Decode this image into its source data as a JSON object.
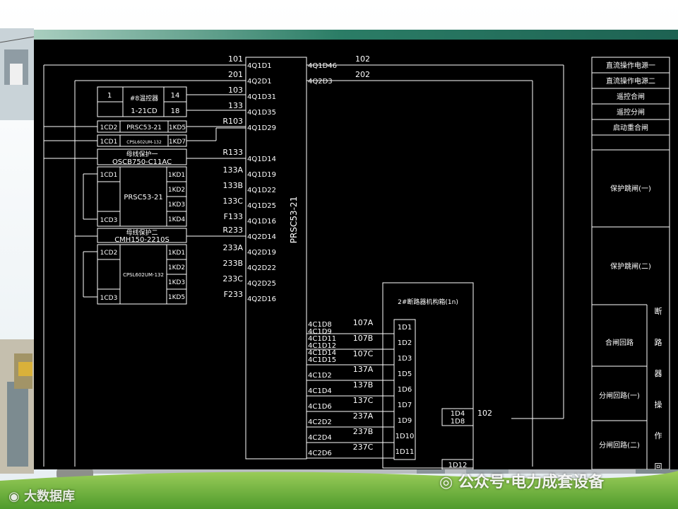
{
  "colors": {
    "panel": "#000000",
    "line": "#ffffff",
    "header_bar": "#1f6f5a",
    "grass": "#6fb23a"
  },
  "left_devices": [
    {
      "ref": "measure",
      "label1": "1",
      "label2": "#8温控器",
      "label3": "1-21CD",
      "label4": "14",
      "label5": "18"
    },
    {
      "ref": "dev2",
      "left": "1CD2",
      "mid": "PRSC53-21",
      "right": "1KD5"
    },
    {
      "ref": "dev3",
      "left": "1CD1",
      "mid": "CPSL602UM-132",
      "right": "1KD7"
    },
    {
      "ref": "bus1",
      "title1": "母线保护一",
      "title2": "OSCB750-C11AC"
    },
    {
      "ref": "prot1",
      "lt": "1CD1",
      "lb": "1CD3",
      "mid": "PRSC53-21",
      "r": [
        "1KD1",
        "1KD2",
        "1KD3",
        "1KD4"
      ]
    },
    {
      "ref": "bus2",
      "title1": "母线保护二",
      "title2": "CMH150-2210S"
    },
    {
      "ref": "prot2",
      "lt": "1CD2",
      "lb": "1CD3",
      "mid": "CPSL602UM-132",
      "r": [
        "1KD1",
        "1KD2",
        "1KD3",
        "1KD5"
      ]
    }
  ],
  "wire_labels_left": [
    "101",
    "201",
    "103",
    "133",
    "R103",
    "R133",
    "133A",
    "133B",
    "133C",
    "F133",
    "R233",
    "233A",
    "233B",
    "233C",
    "F233"
  ],
  "center_left_terms": [
    "4Q1D1",
    "4Q2D1",
    "4Q1D31",
    "4Q1D35",
    "4Q1D29",
    "4Q1D14",
    "4Q1D19",
    "4Q1D22",
    "4Q1D25",
    "4Q1D16",
    "4Q2D14",
    "4Q2D19",
    "4Q2D22",
    "4Q2D25",
    "4Q2D16"
  ],
  "center_right_top_terms": [
    "4Q1D46",
    "4Q2D3"
  ],
  "wire_labels_right_top": [
    "102",
    "202"
  ],
  "center_device_label": "PRSC53-21",
  "center_right_lower_terms": [
    "4C1D8",
    "4C1D9",
    "4C1D11",
    "4C1D12",
    "4C1D14",
    "4C1D15",
    "4C1D2",
    "4C1D4",
    "4C1D6",
    "4C2D2",
    "4C2D4",
    "4C2D6"
  ],
  "wire_labels_lower": [
    "107A",
    "107B",
    "107C",
    "137A",
    "137B",
    "137C",
    "237A",
    "237B",
    "237C"
  ],
  "breaker_box": {
    "title": "2#断路器机构箱(1n)",
    "terms": [
      "1D1",
      "1D2",
      "1D3",
      "1D5",
      "1D6",
      "1D7",
      "1D9",
      "1D10",
      "1D11"
    ],
    "side_terms": [
      "1D4",
      "1D8"
    ],
    "bottom_term": "1D12",
    "wire": "102"
  },
  "legend": [
    "直流操作电源一",
    "直流操作电源二",
    "遥控合闸",
    "遥控分闸",
    "启动重合闸",
    "保护跳闸(一)",
    "保护跳闸(二)",
    "合闸回路",
    "分闸回路(一)",
    "分闸回路(二)"
  ],
  "legend_vertical": "断路器操作回",
  "watermarks": {
    "bottom_left": "大数据库",
    "bottom_right_prefix": "公众号·",
    "bottom_right": "电力成套设备"
  }
}
